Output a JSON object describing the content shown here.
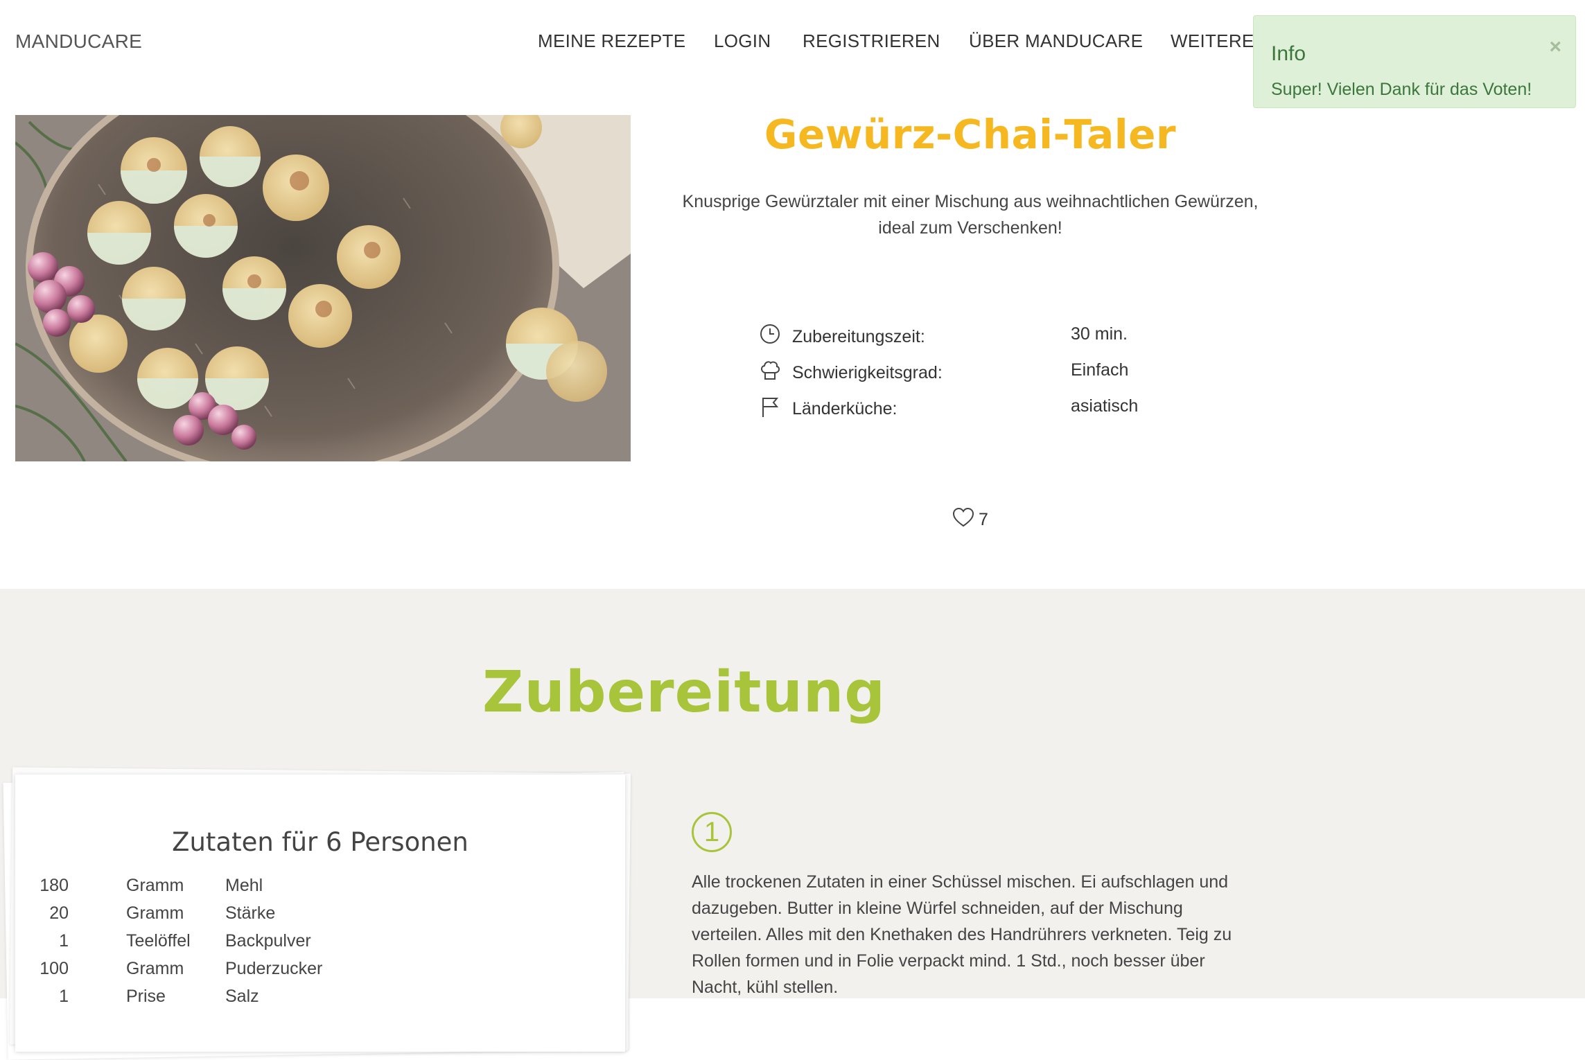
{
  "brand": "MANDUCARE",
  "nav": {
    "items": [
      {
        "label": "MEINE REZEPTE"
      },
      {
        "label": "LOGIN"
      },
      {
        "label": "REGISTRIEREN"
      },
      {
        "label": "ÜBER MANDUCARE"
      },
      {
        "label": "WEITERE"
      }
    ]
  },
  "toast": {
    "title": "Info",
    "message": "Super! Vielen Dank für das Voten!",
    "close": "×",
    "color": "#dff0d8"
  },
  "recipe": {
    "title": "Gewürz-Chai-Taler",
    "subtitle_line1": "Knusprige Gewürztaler mit einer Mischung aus weihnachtlichen Gewürzen,",
    "subtitle_line2": "ideal zum Verschenken!",
    "meta": [
      {
        "icon": "clock-icon",
        "label": "Zubereitungszeit:",
        "value": "30 min."
      },
      {
        "icon": "chef-hat-icon",
        "label": "Schwierigkeitsgrad:",
        "value": "Einfach"
      },
      {
        "icon": "flag-icon",
        "label": "Länderküche:",
        "value": "asiatisch"
      }
    ],
    "likes": "7",
    "title_color": "#f6b820"
  },
  "preparation": {
    "heading": "Zubereitung",
    "accent_color": "#a8c43a",
    "ingredients_heading": "Zutaten für 6 Personen",
    "ingredients": [
      {
        "qty": "180",
        "unit": "Gramm",
        "name": "Mehl"
      },
      {
        "qty": "20",
        "unit": "Gramm",
        "name": "Stärke"
      },
      {
        "qty": "1",
        "unit": "Teelöffel",
        "name": "Backpulver"
      },
      {
        "qty": "100",
        "unit": "Gramm",
        "name": "Puderzucker"
      },
      {
        "qty": "1",
        "unit": "Prise",
        "name": "Salz"
      }
    ],
    "steps": [
      {
        "number": "1",
        "lines": [
          "Alle trockenen Zutaten in einer Schüssel mischen. Ei aufschlagen und",
          "dazugeben. Butter in kleine Würfel schneiden, auf der Mischung",
          "verteilen. Alles mit den Knethaken des Handrührers verkneten. Teig zu",
          "Rollen formen und in Folie verpackt mind. 1 Std., noch besser über",
          "Nacht, kühl stellen."
        ]
      }
    ]
  }
}
